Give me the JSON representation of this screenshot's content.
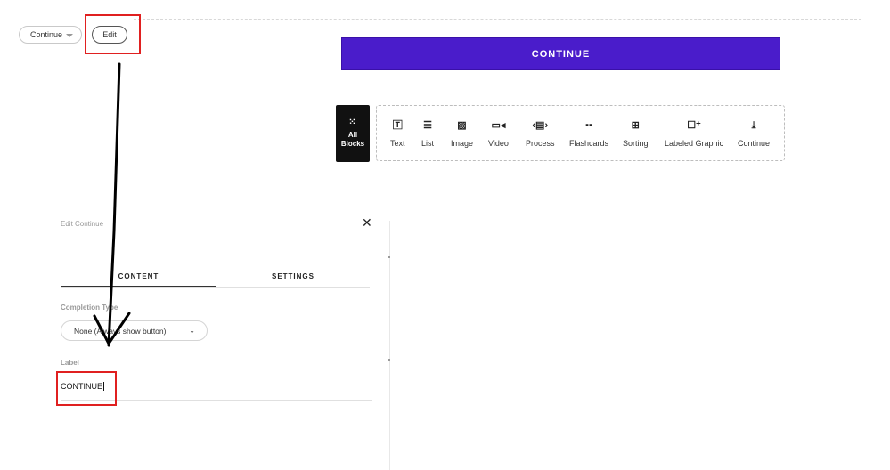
{
  "top": {
    "block_type_select": "Continue",
    "edit_button": "Edit"
  },
  "preview": {
    "continue_button": "CONTINUE"
  },
  "block_bar": {
    "all_blocks_line1": "All",
    "all_blocks_line2": "Blocks",
    "items": [
      {
        "label": "Text",
        "icon": "text-icon"
      },
      {
        "label": "List",
        "icon": "list-icon"
      },
      {
        "label": "Image",
        "icon": "image-icon"
      },
      {
        "label": "Video",
        "icon": "video-icon"
      },
      {
        "label": "Process",
        "icon": "process-icon"
      },
      {
        "label": "Flashcards",
        "icon": "flashcards-icon"
      },
      {
        "label": "Sorting",
        "icon": "sorting-icon"
      },
      {
        "label": "Labeled Graphic",
        "icon": "labeled-graphic-icon"
      },
      {
        "label": "Continue",
        "icon": "continue-icon"
      }
    ]
  },
  "panel": {
    "title": "Edit Continue",
    "tabs": [
      "CONTENT",
      "SETTINGS"
    ],
    "completion_type_label": "Completion Type",
    "completion_type_value": "None (Always show button)",
    "label_label": "Label",
    "label_value": "CONTINUE"
  },
  "colors": {
    "accent": "#4a1ccb",
    "highlight": "#e02020"
  }
}
